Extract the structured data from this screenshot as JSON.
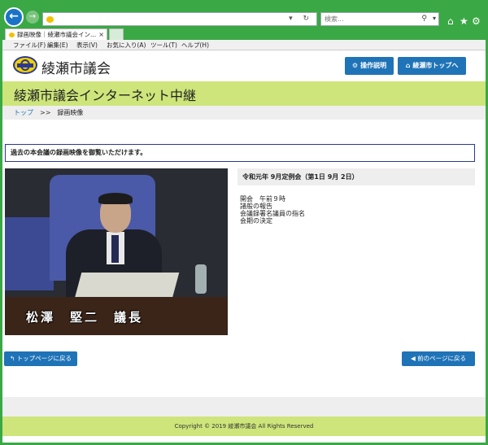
{
  "browser": {
    "address_value": "",
    "search_placeholder": "検索...",
    "tab_title": "録画映像｜綾瀬市議会イン...",
    "menu": [
      "ファイル(F)",
      "編集(E)",
      "表示(V)",
      "お気に入り(A)",
      "ツール(T)",
      "ヘルプ(H)"
    ],
    "icons": {
      "back": "arrow-left",
      "forward": "arrow-right",
      "search": "magnifier",
      "home": "house",
      "favorites": "star",
      "settings": "gear"
    }
  },
  "header": {
    "site_name": "綾瀬市議会",
    "buttons": [
      {
        "label": "操作説明",
        "icon": "gear-icon"
      },
      {
        "label": "綾瀬市トップへ",
        "icon": "home-icon"
      }
    ]
  },
  "banner": {
    "title": "綾瀬市議会インターネット中継"
  },
  "breadcrumb": {
    "home": "トップ",
    "separator": ">>",
    "current": "録画映像"
  },
  "notice": "過去の本会議の録画映像を御覧いただけます。",
  "video": {
    "caption": "松澤　堅二　議長"
  },
  "session": {
    "title": "令和元年 9月定例会（第1日 9月 2日）",
    "agenda": [
      "開会　午前９時",
      "諸般の報告",
      "会議録署名議員の指名",
      "会期の決定"
    ]
  },
  "nav": {
    "top_label": "トップページに戻る",
    "back_label": "前のページに戻る"
  },
  "footer": {
    "copyright": "Copyright © 2019 綾瀬市議会 All Rights Reserved"
  },
  "colors": {
    "chrome": "#3aa845",
    "accent_blue": "#1f73b7",
    "banner_green": "#cde57a",
    "logo_navy": "#2b3990",
    "logo_yellow": "#f2d000"
  }
}
